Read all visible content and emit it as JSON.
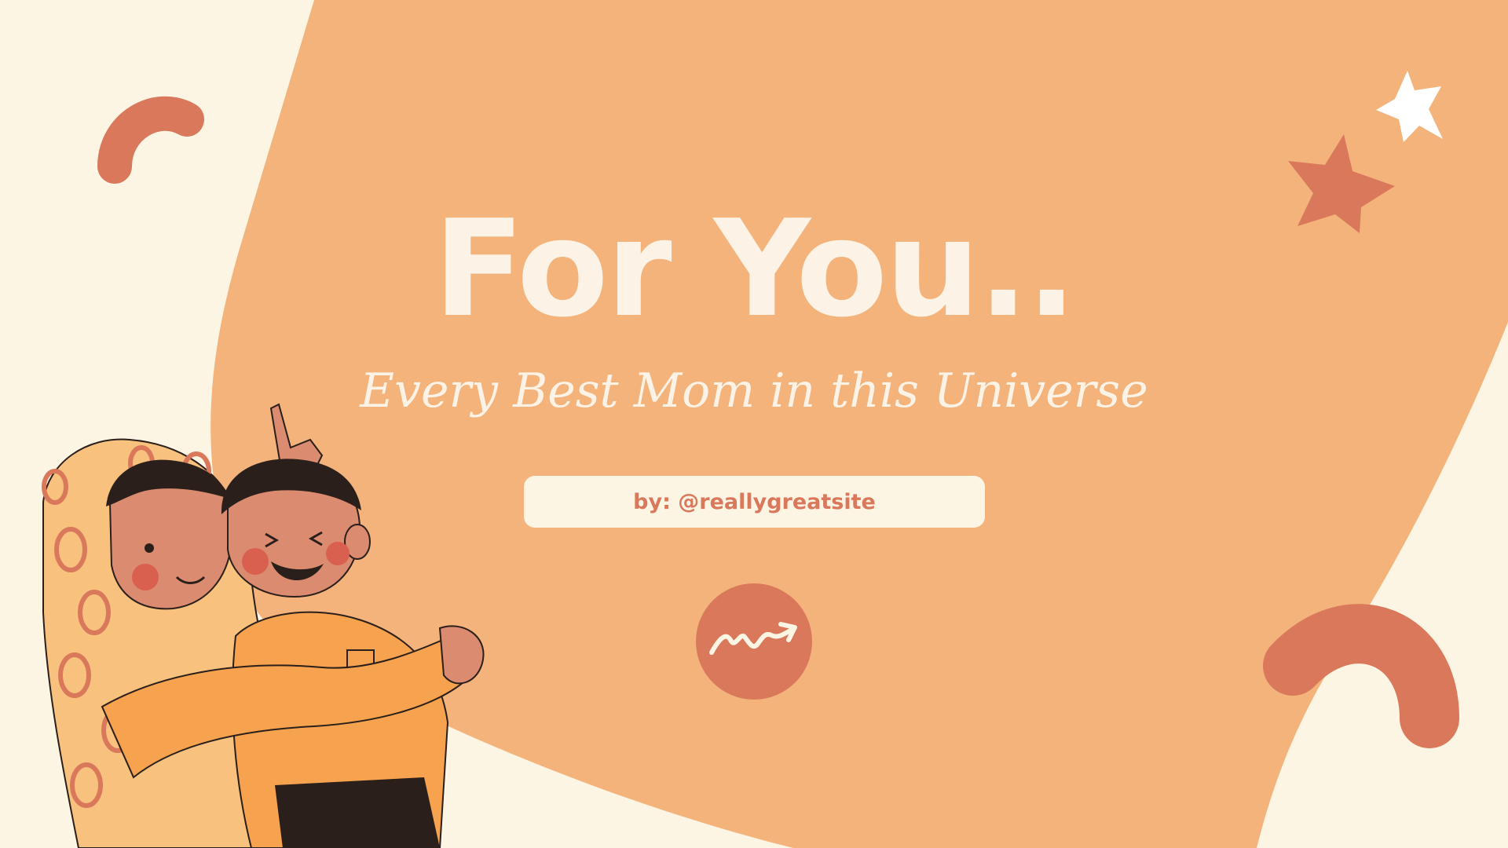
{
  "card": {
    "title": "For You..",
    "subtitle": "Every Best Mom in this Universe",
    "byline": "by: @reallygreatsite"
  },
  "colors": {
    "background": "#FDF5E4",
    "blob": "#F3B37B",
    "accent": "#D9785B",
    "text_light": "#FCF3E6",
    "white": "#FFFFFF"
  },
  "icons": {
    "logo": "squiggle-arrow-icon",
    "stars": [
      "star-icon-white",
      "star-icon-coral"
    ],
    "arcs": [
      "arc-shape-top-left",
      "arc-shape-bottom-right"
    ],
    "illustration": "mother-hugging-child-illustration"
  }
}
